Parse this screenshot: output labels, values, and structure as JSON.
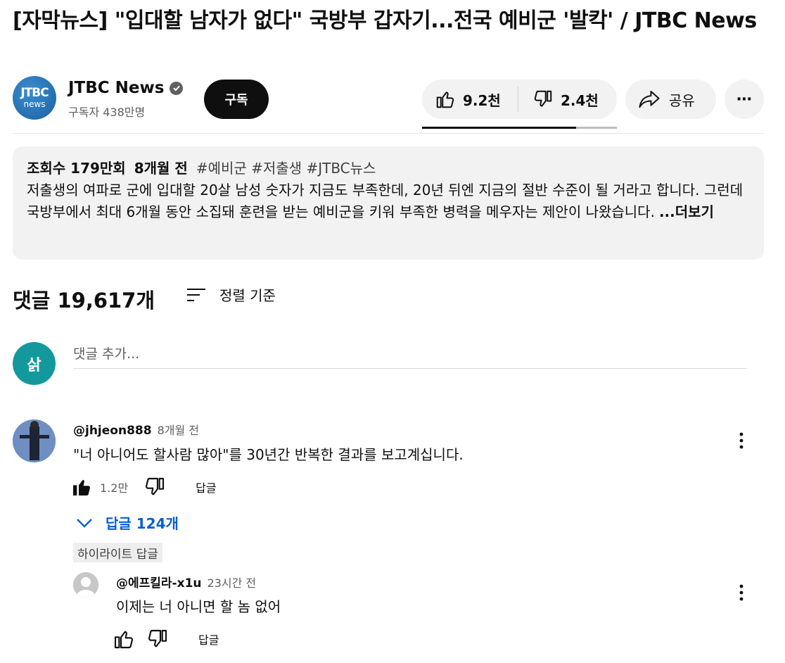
{
  "video": {
    "title": "[자막뉴스] \"입대할 남자가 없다\" 국방부 갑자기...전국 예비군 '발칵' / JTBC News"
  },
  "channel": {
    "avatar_line1": "JTBC",
    "avatar_line2": "news",
    "name": "JTBC News",
    "subscribers": "구독자 438만명",
    "subscribe_label": "구독"
  },
  "actions": {
    "likes": "9.2천",
    "dislikes": "2.4천",
    "like_ratio": 0.79,
    "share_label": "공유",
    "more_label": "⋯"
  },
  "description": {
    "views": "조회수 179만회",
    "age": "8개월 전",
    "hashtags": "#예비군 #저출생 #JTBC뉴스",
    "body": "저출생의 여파로 군에 입대할 20살 남성 숫자가 지금도 부족한데, 20년 뒤엔 지금의 절반 수준이 될 거라고 합니다. 그런데 국방부에서 최대 6개월 동안 소집돼 훈련을 받는 예비군을 키워 부족한 병력을 메우자는 제안이 나왔습니다.",
    "more_label": "...더보기"
  },
  "comments": {
    "count_label": "댓글 19,617개",
    "sort_label": "정렬 기준",
    "add_placeholder": "댓글 추가...",
    "my_avatar_text": "삵",
    "items": [
      {
        "author": "@jhjeon888",
        "time": "8개월 전",
        "text": "\"너 아니어도 할사람 많아\"를 30년간 반복한 결과를 보고계십니다.",
        "likes": "1.2만",
        "reply_label": "답글",
        "replies_toggle": "답글 124개",
        "highlight_chip": "하이라이트 답글"
      }
    ],
    "reply": {
      "author": "@에프킬라-x1u",
      "time": "23시간 전",
      "text": "이제는 너 아니면 할 놈 없어",
      "reply_label": "답글"
    }
  }
}
